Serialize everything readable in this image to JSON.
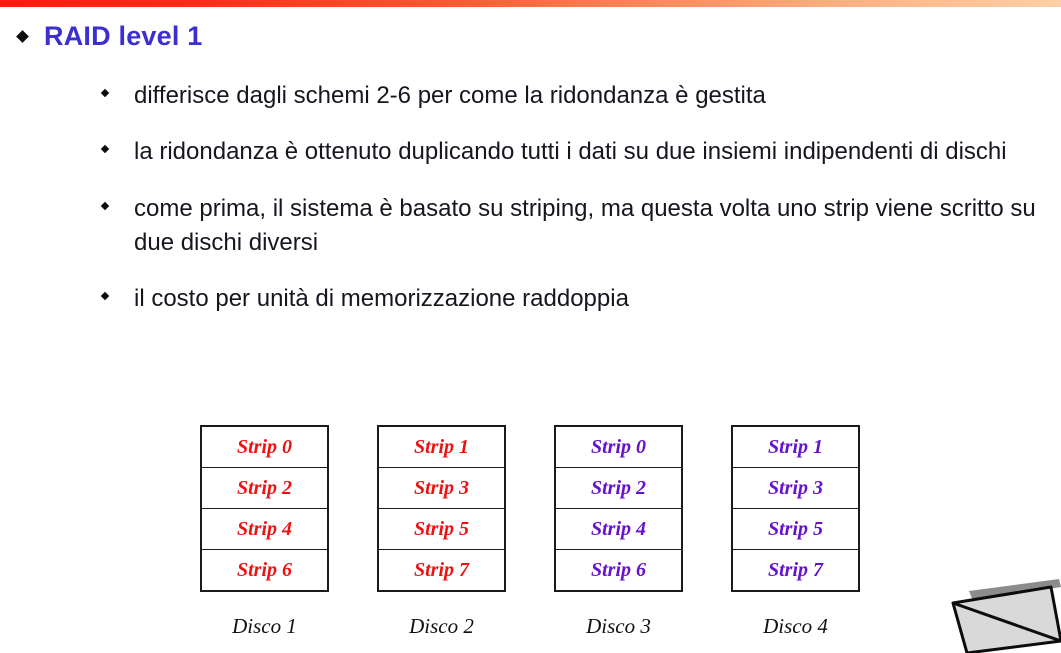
{
  "slide": {
    "title": "RAID level 1",
    "title_color": "#3b2fd0",
    "top_bar": {
      "gradient_from": "#ff1a0d",
      "gradient_to": "#ffcfa6"
    },
    "bullets": [
      "differisce dagli schemi 2-6 per come la ridondanza è gestita",
      "la ridondanza è ottenuto duplicando tutti i dati su due insiemi indipendenti di dischi",
      "come prima, il sistema è basato su striping, ma questa volta uno strip viene scritto su due dischi diversi",
      "il costo per unità di memorizzazione raddoppia"
    ]
  },
  "diagram": {
    "type": "raid-strip-table",
    "colors": {
      "primary_set": "#ee1111",
      "mirror_set": "#6611cc",
      "label": "#111111",
      "border": "#1a1a1a"
    },
    "columns": [
      {
        "label": "Disco 1",
        "color": "#ee1111",
        "cells": [
          "Strip 0",
          "Strip 2",
          "Strip 4",
          "Strip 6"
        ]
      },
      {
        "label": "Disco 2",
        "color": "#ee1111",
        "cells": [
          "Strip 1",
          "Strip 3",
          "Strip 5",
          "Strip 7"
        ]
      },
      {
        "label": "Disco 3",
        "color": "#6611cc",
        "cells": [
          "Strip 0",
          "Strip 2",
          "Strip 4",
          "Strip 6"
        ]
      },
      {
        "label": "Disco 4",
        "color": "#6611cc",
        "cells": [
          "Strip 1",
          "Strip 3",
          "Strip 5",
          "Strip 7"
        ]
      }
    ]
  }
}
